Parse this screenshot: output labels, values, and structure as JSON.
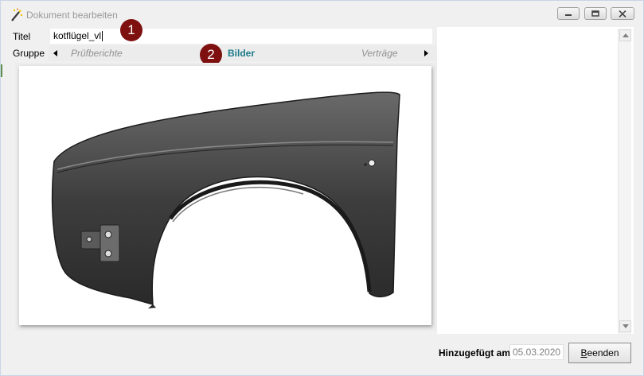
{
  "window": {
    "title": "Dokument bearbeiten",
    "icon": "magic-wand-icon",
    "controls": [
      "minimize-icon",
      "maximize-icon",
      "close-icon"
    ]
  },
  "form": {
    "titel_label": "Titel",
    "titel_value": "kotflügel_vl",
    "gruppe_label": "Gruppe"
  },
  "group_nav": {
    "prev_icon": "triangle-left-icon",
    "next_icon": "triangle-right-icon",
    "tabs": [
      {
        "label": "Prüfberichte",
        "active": false
      },
      {
        "label": "Bilder",
        "active": true
      },
      {
        "label": "Verträge",
        "active": false
      }
    ]
  },
  "annotations": [
    {
      "number": "1"
    },
    {
      "number": "2"
    }
  ],
  "image": {
    "content": "car-fender-image"
  },
  "footer": {
    "added_label": "Hinzugefügt am",
    "added_value": "05.03.2020",
    "close_button_first": "B",
    "close_button_rest": "eenden"
  },
  "colors": {
    "badge": "#7e1010",
    "active_tab": "#1c7a8a",
    "inactive_tab": "#909090"
  }
}
